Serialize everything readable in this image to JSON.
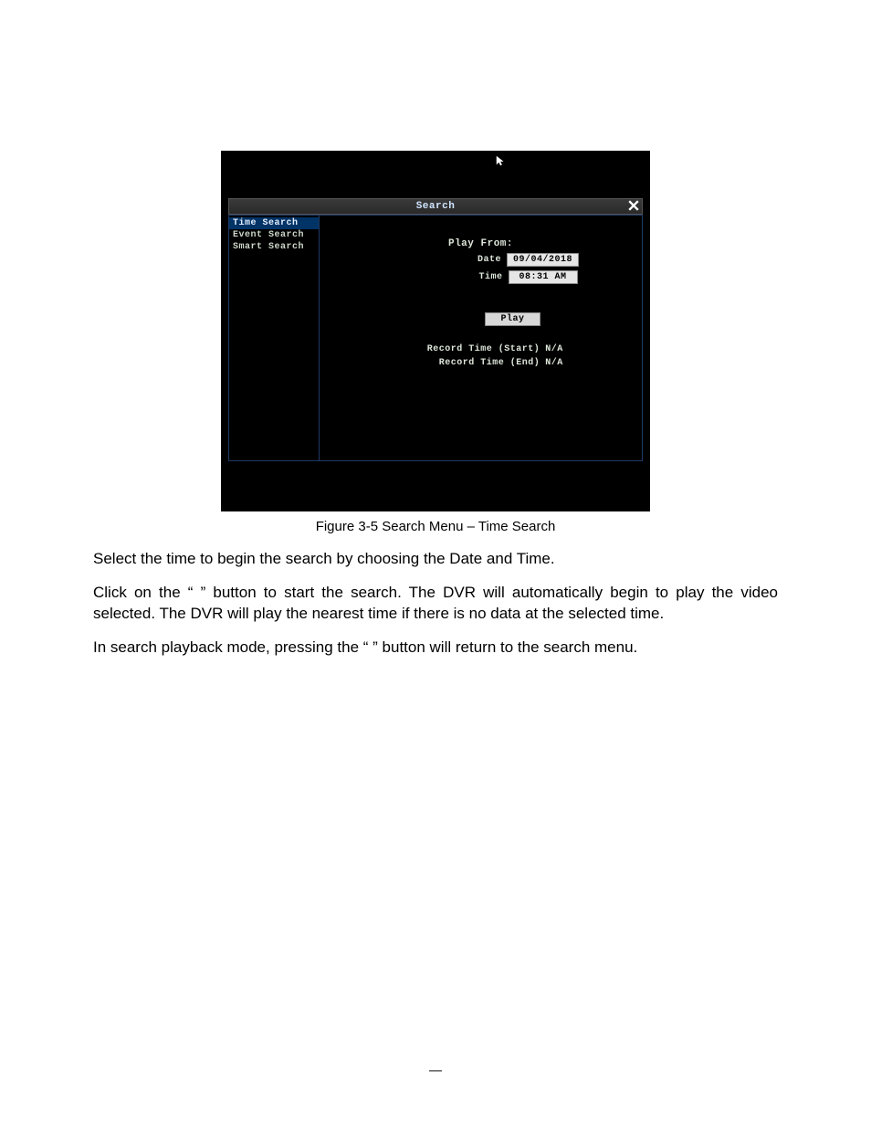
{
  "dvr": {
    "title": "Search",
    "sidebar": {
      "items": [
        {
          "label": "Time Search",
          "selected": true
        },
        {
          "label": "Event Search",
          "selected": false
        },
        {
          "label": "Smart Search",
          "selected": false
        }
      ]
    },
    "content": {
      "play_from_label": "Play From:",
      "date_label": "Date",
      "date_value": "09/04/2018",
      "time_label": "Time",
      "time_value": "08:31 AM",
      "play_button": "Play",
      "record_start_label": "Record Time (Start)",
      "record_start_value": "N/A",
      "record_end_label": "Record Time (End)",
      "record_end_value": "N/A"
    }
  },
  "caption": "Figure 3-5 Search Menu – Time Search",
  "paragraphs": {
    "p1": "Select the time to begin the search by choosing the Date and Time.",
    "p2": "Click on the “      ” button to start the search. The DVR will automatically begin to play the video selected. The DVR will play the nearest time if there is no data at the selected time.",
    "p3": "In search playback mode, pressing the “       ” button will return to the search menu."
  },
  "page_number": "—"
}
